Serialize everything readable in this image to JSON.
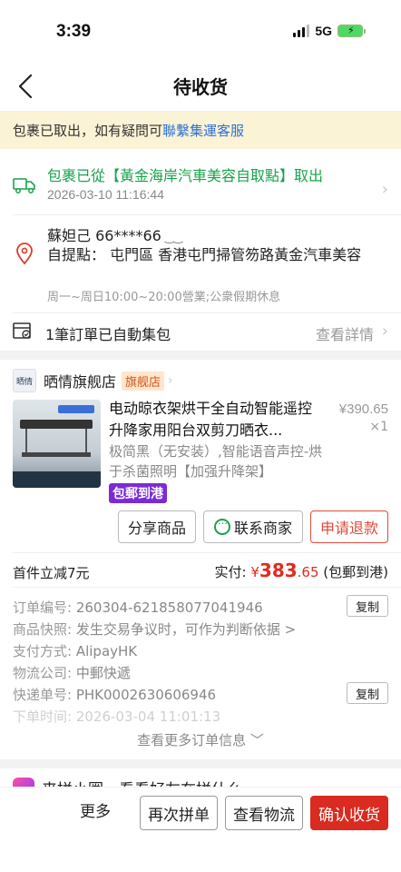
{
  "status_bar": {
    "time": "3:39",
    "network": "5G"
  },
  "nav": {
    "title": "待收货"
  },
  "notice": {
    "text": "包裹已取出，如有疑問可",
    "link": "聯繫集運客服"
  },
  "pickup": {
    "title": "包裹已從【黃金海岸汽車美容自取點】取出",
    "time": "2026-03-10 11:16:44"
  },
  "address": {
    "name": "蘇妲己 66****66",
    "detail": "自提點： 屯門區 香港屯門掃管笏路黃金汽車美容",
    "hours": "周一~周日10:00~20:00營業;公衆假期休息"
  },
  "package": {
    "text": "1筆訂單已自動集包",
    "link": "查看詳情"
  },
  "shop": {
    "logo_text": "晒情",
    "name": "晒情旗舰店",
    "badge": "旗舰店"
  },
  "product": {
    "title": "电动晾衣架烘干全自动智能遥控升降家用阳台双剪刀晒衣...",
    "price": "¥390.65",
    "qty": "×1",
    "spec": "极简黑（无安装）,智能语音声控-烘于杀菌照明【加强升降架】",
    "tag": "包郵到港"
  },
  "actions": {
    "share": "分享商品",
    "contact": "联系商家",
    "refund": "申请退款"
  },
  "summary": {
    "discount": "首件立减7元",
    "paid_label": "实付: ",
    "currency": "¥",
    "amount_int": "383",
    "amount_dec": ".65",
    "note": " (包郵到港)"
  },
  "order_info": [
    {
      "key": "订单编号: ",
      "value": "260304-621858077041946",
      "copy": "复制"
    },
    {
      "key": "商品快照: ",
      "value": "发生交易争议时，可作为判断依据 >"
    },
    {
      "key": "支付方式: ",
      "value": "AlipayHK"
    },
    {
      "key": "物流公司: ",
      "value": "中郵快遞"
    },
    {
      "key": "快递单号: ",
      "value": "PHK0002630606946",
      "copy": "复制"
    },
    {
      "key": "下单时间: ",
      "value": "2026-03-04 11:01:13"
    }
  ],
  "more_info": "查看更多订单信息",
  "peek": {
    "text": "来拼小圈，看看好友在拼什么"
  },
  "bottom": {
    "more": "更多",
    "rebuy": "再次拼单",
    "logistics": "查看物流",
    "confirm": "确认收货"
  }
}
